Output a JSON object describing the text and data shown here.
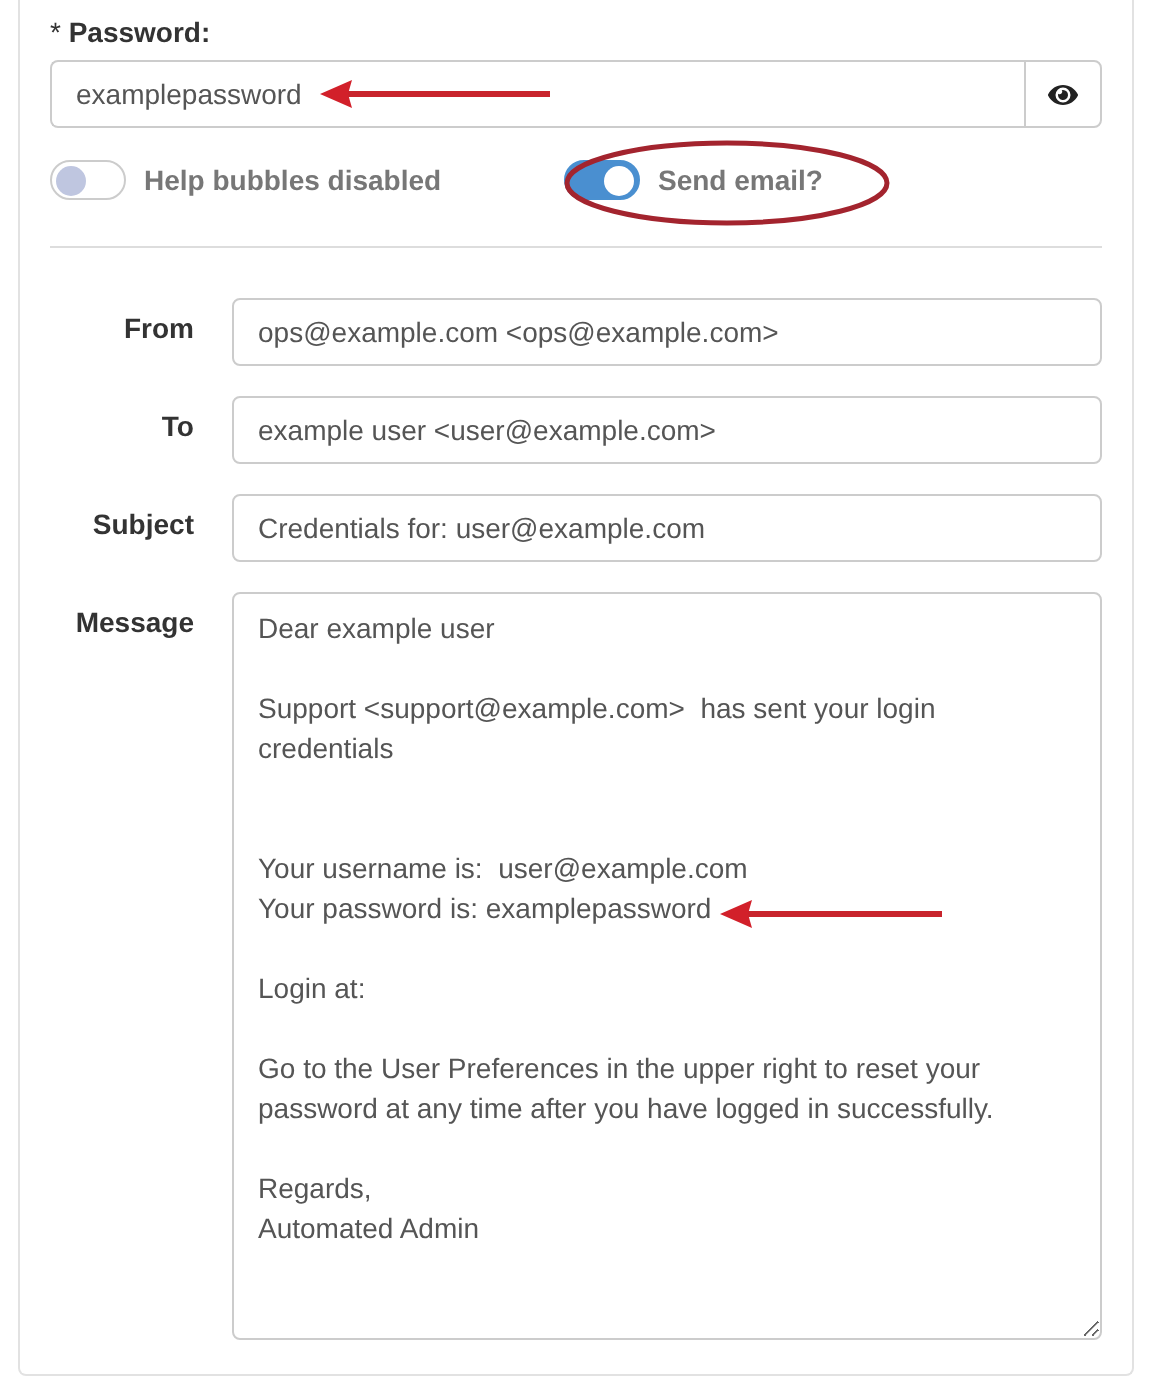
{
  "password": {
    "label": "* **Password:**",
    "value": "examplepassword"
  },
  "toggles": [
    {
      "label": "Help bubbles disabled",
      "on": false
    },
    {
      "label": "Send email?",
      "on": true
    }
  ],
  "email_fields": [
    {
      "label": "From",
      "value": "ops@example.com <ops@example.com>"
    },
    {
      "label": "To",
      "value": "example user <user@example.com>"
    },
    {
      "label": "Subject",
      "value": "Credentials for: user@example.com"
    }
  ],
  "message": {
    "label": "Message",
    "value": "Dear example user\n\nSupport <support@example.com>  has sent your login\ncredentials\n\n\nYour username is:  user@example.com\nYour password is: examplepassword\n\nLogin at:\n\nGo to the User Preferences in the upper right to reset your\npassword at any time after you have logged in successfully.\n\nRegards,\nAutomated Admin"
  }
}
